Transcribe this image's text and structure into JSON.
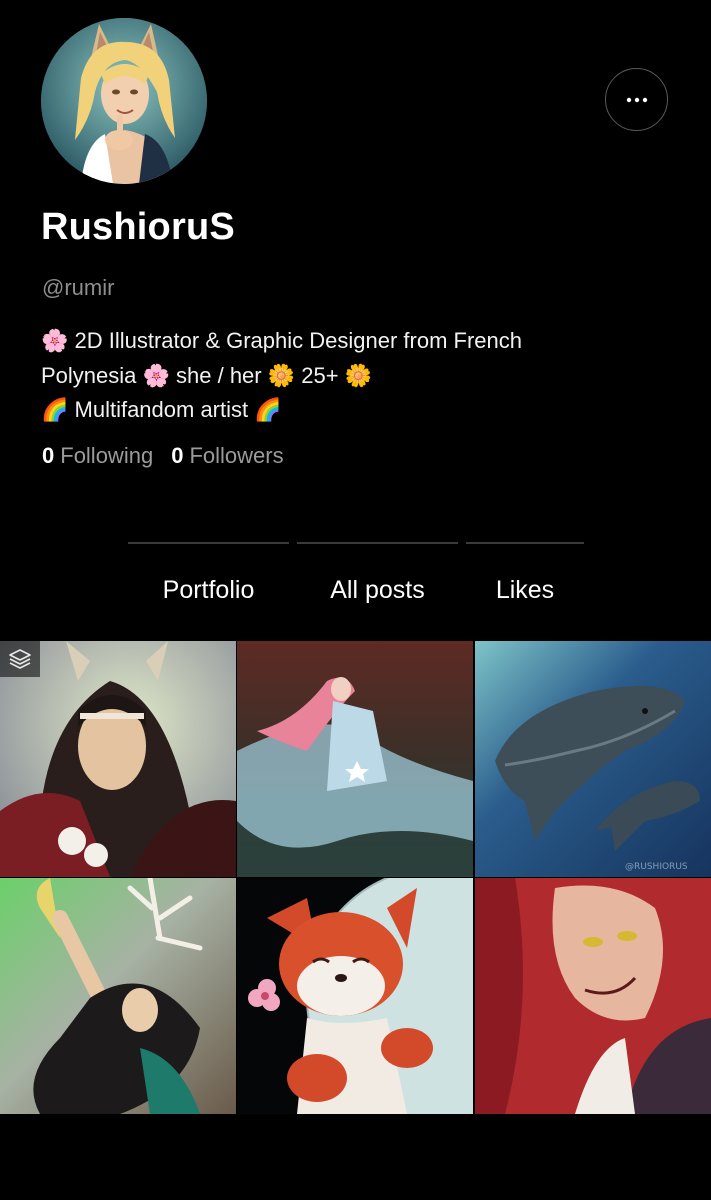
{
  "profile": {
    "display_name": "RushioruS",
    "handle": "@rumir",
    "avatar_alt": "avatar",
    "bio_lines": [
      "🌸 2D Illustrator & Graphic Designer from French",
      "Polynesia 🌸 she / her 🌼 25+ 🌼",
      "🌈 Multifandom artist 🌈"
    ]
  },
  "stats": {
    "following_count": "0",
    "following_label": "Following",
    "followers_count": "0",
    "followers_label": "Followers"
  },
  "tabs": [
    {
      "label": "Portfolio"
    },
    {
      "label": "All posts"
    },
    {
      "label": "Likes"
    }
  ],
  "menu": {
    "icon": "more-horizontal-icon"
  },
  "gallery": {
    "items": [
      {
        "subject": "fox-eared swordsman with long dark hair",
        "badge_icon": "layers-icon"
      },
      {
        "subject": "pink-haired figure in flowing starry cape"
      },
      {
        "subject": "whale and calf swimming in blue water"
      },
      {
        "subject": "dark-haired figure reaching with antler branches"
      },
      {
        "subject": "smiling red fox with pink flower"
      },
      {
        "subject": "red-haired woman with golden eyes"
      }
    ]
  },
  "colors": {
    "background": "#000000",
    "text": "#ffffff",
    "muted": "#8e8e8e",
    "rule": "#3a3a3a"
  }
}
